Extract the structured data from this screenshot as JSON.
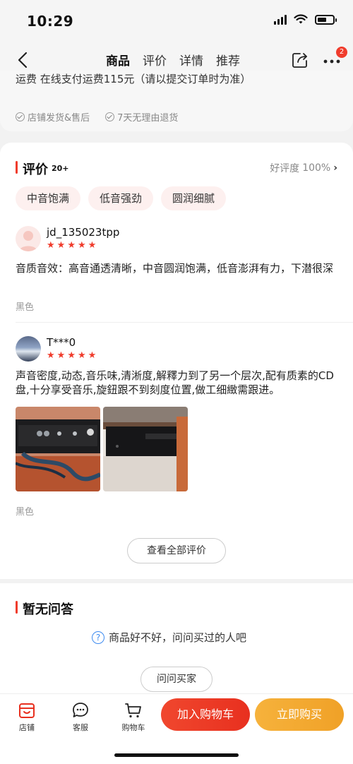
{
  "status_bar": {
    "time": "10:29"
  },
  "nav": {
    "tabs": [
      {
        "label": "商品",
        "active": true
      },
      {
        "label": "评价",
        "active": false
      },
      {
        "label": "详情",
        "active": false
      },
      {
        "label": "推荐",
        "active": false
      }
    ],
    "more_badge": "2",
    "back_icon": "chevron-left-icon",
    "share_icon": "share-icon",
    "more_icon": "more-dots-icon"
  },
  "product_info": {
    "freight": "运费   在线支付运费115元（请以提交订单时为准）",
    "services": [
      "店铺发货&售后",
      "7天无理由退货"
    ]
  },
  "reviews": {
    "title": "评价",
    "count": "20+",
    "good_rate_label": "好评度",
    "good_rate_value": "100%",
    "tags": [
      "中音饱满",
      "低音强劲",
      "圆润细腻"
    ],
    "items": [
      {
        "username": "jd_135023tpp",
        "rating": 5,
        "text": "音质音效：高音通透清晰，中音圆润饱满，低音澎湃有力，下潜很深",
        "variant": "黑色"
      },
      {
        "username": "T***0",
        "rating": 5,
        "text": "声音密度,动态,音乐味,清淅度,解釋力到了另一个层次,配有质素的CD盘,十分享受音乐,旋鈕跟不到刻度位置,做工细緻需跟进。",
        "variant": "黑色"
      }
    ],
    "view_all_label": "查看全部评价"
  },
  "qa": {
    "title": "暂无问答",
    "hint": "商品好不好，问问买过的人吧",
    "ask_label": "问问买家"
  },
  "bottom_bar": {
    "shop_label": "店铺",
    "service_label": "客服",
    "cart_label": "购物车",
    "add_to_cart_label": "加入购物车",
    "buy_now_label": "立即购买"
  },
  "colors": {
    "accent": "#f03c2c",
    "buy": "#f0a127",
    "tag_bg": "#fdf0ef"
  }
}
